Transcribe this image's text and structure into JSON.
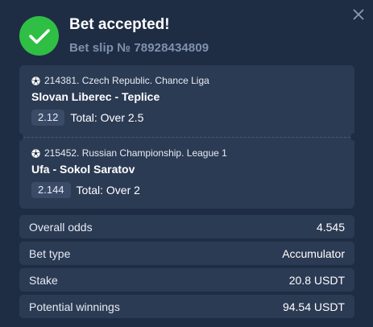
{
  "header": {
    "title": "Bet accepted!",
    "subtitle": "Bet slip № 78928434809"
  },
  "events": [
    {
      "meta": "214381. Czech Republic. Chance Liga",
      "teams": "Slovan Liberec - Teplice",
      "odds": "2.12",
      "market": "Total: Over 2.5"
    },
    {
      "meta": "215452. Russian Championship. League 1",
      "teams": "Ufa - Sokol Saratov",
      "odds": "2.144",
      "market": "Total: Over 2"
    }
  ],
  "summary": {
    "overall_odds": {
      "label": "Overall odds",
      "value": "4.545"
    },
    "bet_type": {
      "label": "Bet type",
      "value": "Accumulator"
    },
    "stake": {
      "label": "Stake",
      "value": "20.8 USDT"
    },
    "potential_winnings": {
      "label": "Potential winnings",
      "value": "94.54 USDT"
    }
  },
  "icons": {
    "success": "check-circle-icon",
    "close": "close-icon",
    "sport": "soccer-ball-icon"
  },
  "colors": {
    "background": "#1f2d44",
    "card": "#2c3b54",
    "success": "#2fbf45",
    "muted_text": "#7f91ad"
  }
}
